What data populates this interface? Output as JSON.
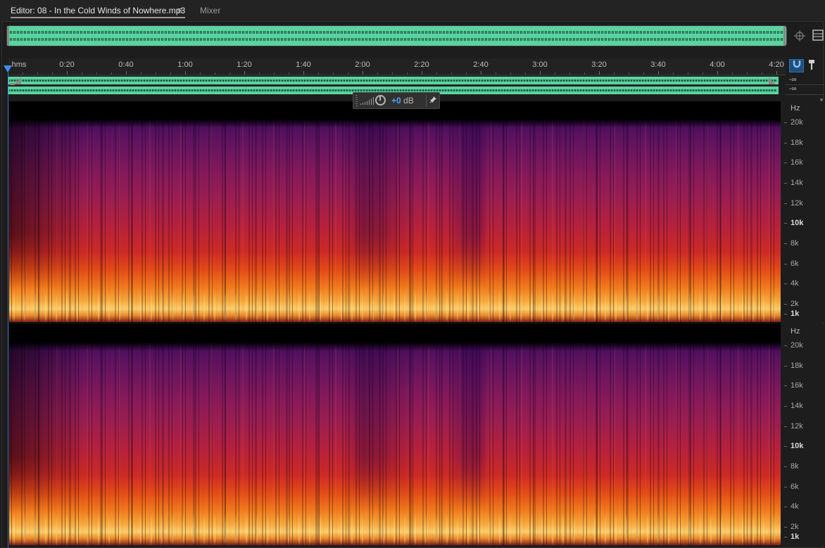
{
  "tabs": {
    "editor": "Editor: 08 - In the Cold Winds of Nowhere.mp3",
    "editor_menu_icon": "≡",
    "mixer": "Mixer"
  },
  "ruler": {
    "format": "hms",
    "labels": [
      "0:20",
      "0:40",
      "1:00",
      "1:20",
      "1:40",
      "2:00",
      "2:20",
      "2:40",
      "3:00",
      "3:20",
      "3:40",
      "4:00",
      "4:20"
    ]
  },
  "levels": {
    "ch1": "-∞",
    "ch2": "-∞"
  },
  "hud": {
    "value": "+0",
    "unit": "dB"
  },
  "frequency_axis": {
    "unit": "Hz",
    "labels": [
      "20k",
      "18k",
      "16k",
      "14k",
      "12k",
      "10k",
      "8k",
      "6k",
      "4k",
      "2k",
      "1k"
    ],
    "major": [
      "10k",
      "1k"
    ]
  },
  "icons": {
    "zoom_overview": "target-icon",
    "display_toggle": "display-icon",
    "snap": "magnet-icon",
    "marker": "marker-icon",
    "hud_pin": "pin-icon",
    "hud_knob": "volume-knob-icon"
  },
  "colors": {
    "waveform": "#5bd3a0",
    "playhead": "#3a8fe8",
    "accent": "#4ea3ff"
  }
}
